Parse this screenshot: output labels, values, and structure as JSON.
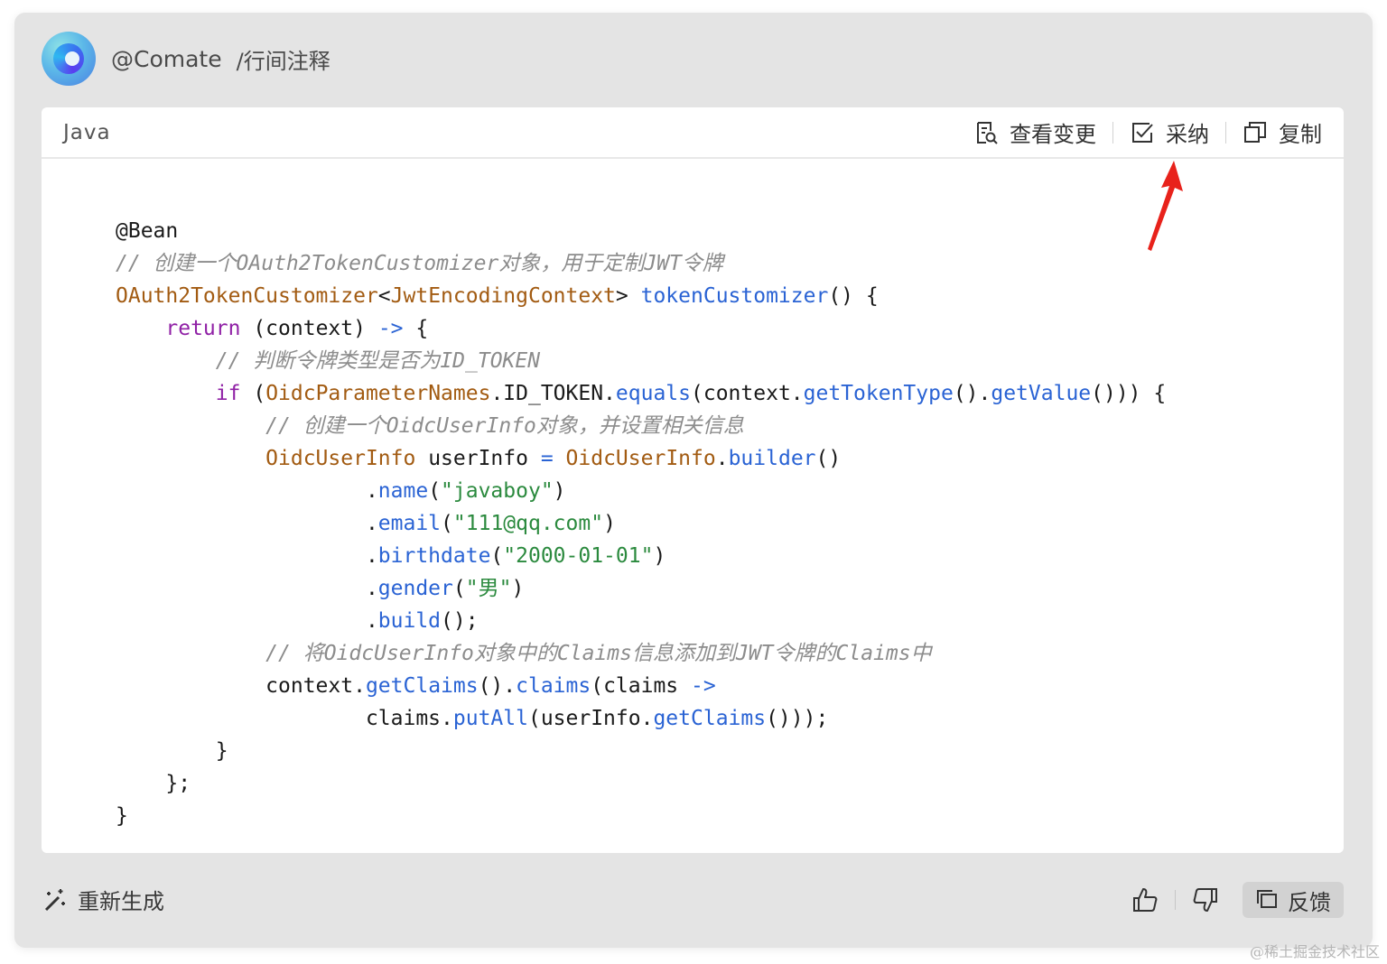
{
  "header": {
    "agent_name": "@Comate",
    "command": "/行间注释"
  },
  "code_block": {
    "language": "Java",
    "actions": {
      "view_changes": "查看变更",
      "adopt": "采纳",
      "copy": "复制"
    }
  },
  "footer": {
    "regenerate_label": "重新生成",
    "feedback_label": "反馈"
  },
  "watermark": "@稀土掘金技术社区",
  "code_lines": [
    "@Bean",
    "// 创建一个OAuth2TokenCustomizer对象，用于定制JWT令牌",
    "OAuth2TokenCustomizer<JwtEncodingContext> tokenCustomizer() {",
    "    return (context) -> {",
    "        // 判断令牌类型是否为ID_TOKEN",
    "        if (OidcParameterNames.ID_TOKEN.equals(context.getTokenType().getValue())) {",
    "            // 创建一个OidcUserInfo对象，并设置相关信息",
    "            OidcUserInfo userInfo = OidcUserInfo.builder()",
    "                    .name(\"javaboy\")",
    "                    .email(\"111@qq.com\")",
    "                    .birthdate(\"2000-01-01\")",
    "                    .gender(\"男\")",
    "                    .build();",
    "            // 将OidcUserInfo对象中的Claims信息添加到JWT令牌的Claims中",
    "            context.getClaims().claims(claims ->",
    "                    claims.putAll(userInfo.getClaims()));",
    "        }",
    "    };",
    "}"
  ],
  "colors": {
    "comment": "#8c8c8c",
    "class": "#a25b12",
    "method": "#2a63d4",
    "keyword": "#9021a6",
    "string": "#2b8a3e",
    "arrow": "#e8221b"
  }
}
